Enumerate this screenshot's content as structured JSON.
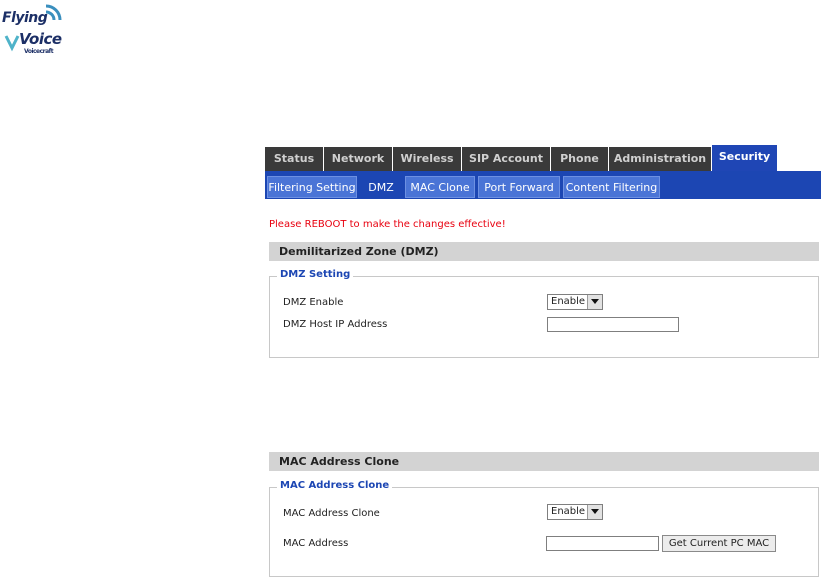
{
  "logo": {
    "line1": "Flying",
    "line2": "Voice",
    "line3": "Voicecraft"
  },
  "main_tabs": [
    "Status",
    "Network",
    "Wireless",
    "SIP Account",
    "Phone",
    "Administration",
    "Security"
  ],
  "active_main_tab": "Security",
  "sub_tabs": [
    "Filtering Setting",
    "DMZ",
    "MAC Clone",
    "Port Forward",
    "Content Filtering"
  ],
  "active_sub_tab": "DMZ",
  "notice": "Please REBOOT to make the changes effective!",
  "dmz": {
    "section_title": "Demilitarized Zone (DMZ)",
    "legend": "DMZ Setting",
    "enable_label": "DMZ Enable",
    "enable_value": "Enable",
    "host_ip_label": "DMZ Host IP Address",
    "host_ip_value": ""
  },
  "mac_clone": {
    "section_title": "MAC Address Clone",
    "legend": "MAC Address Clone",
    "clone_label": "MAC Address Clone",
    "clone_value": "Enable",
    "mac_label": "MAC Address",
    "mac_value": "",
    "get_mac_button": "Get Current PC MAC"
  },
  "colors": {
    "tab_dark": "#3a3a3a",
    "tab_active": "#1f46b5",
    "subtab_bar": "#1c46b3",
    "subtab": "#4a74d6",
    "notice": "#e8000f",
    "section_header": "#d3d3d3",
    "legend": "#1c46b3"
  }
}
